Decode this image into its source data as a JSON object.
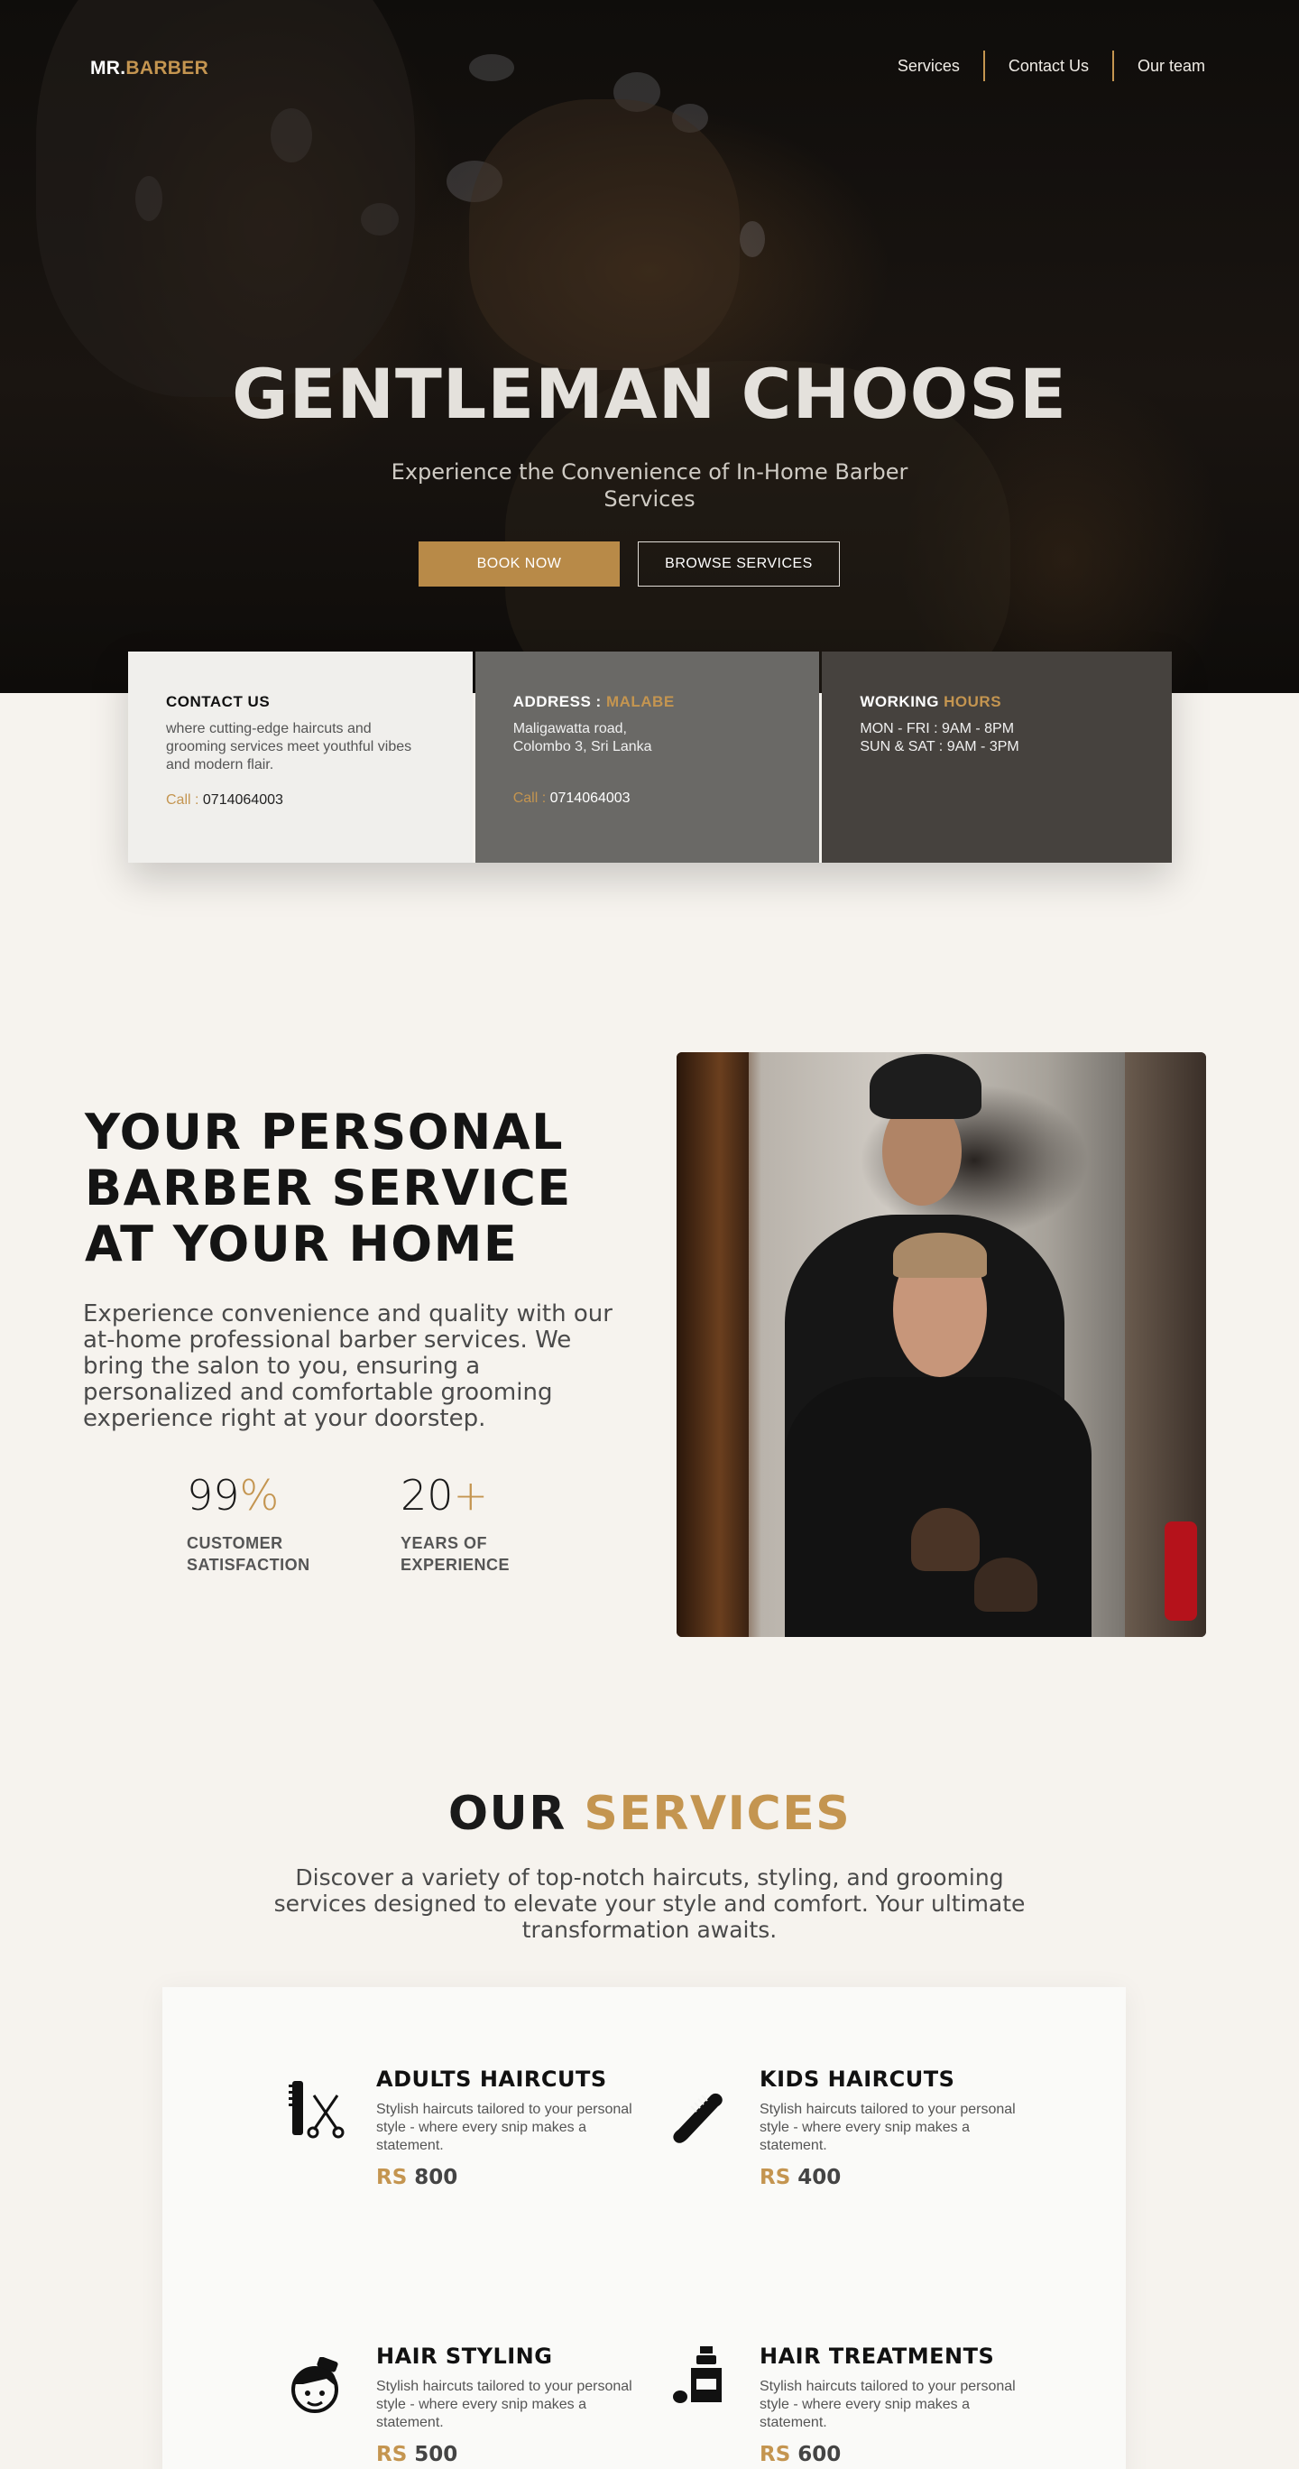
{
  "brand": {
    "part1": "MR.",
    "part2": "BARBER"
  },
  "nav": {
    "items": [
      "Services",
      "Contact Us",
      "Our team"
    ]
  },
  "hero": {
    "title": "GENTLEMAN CHOOSE",
    "subtitle": "Experience the Convenience of In-Home Barber Services",
    "book_label": "BOOK NOW",
    "browse_label": "BROWSE SERVICES"
  },
  "cards": {
    "contact": {
      "title": "CONTACT US",
      "text": "where cutting-edge haircuts and grooming services meet youthful vibes and modern flair.",
      "call_label": "Call :",
      "phone": "0714064003"
    },
    "address": {
      "title": "ADDRESS :",
      "title_accent": "MALABE",
      "line1": "Maligawatta road,",
      "line2": "Colombo 3, Sri Lanka",
      "call_label": "Call :",
      "phone": "0714064003"
    },
    "hours": {
      "title": "WORKING",
      "title_accent": "HOURS",
      "line1": "MON - FRI : 9AM - 8PM",
      "line2": "SUN & SAT : 9AM - 3PM"
    }
  },
  "about": {
    "title": "YOUR PERSONAL BARBER SERVICE AT YOUR HOME",
    "text": "Experience convenience and quality with our at-home professional barber services. We bring the salon to you, ensuring a personalized and comfortable grooming experience right at your doorstep.",
    "stats": [
      {
        "number": "99",
        "suffix": "%",
        "label1": "CUSTOMER",
        "label2": "SATISFACTION"
      },
      {
        "number": "20",
        "suffix": "+",
        "label1": "YEARS OF",
        "label2": "EXPERIENCE"
      }
    ]
  },
  "services": {
    "title1": "OUR",
    "title2": "SERVICES",
    "subtitle": "Discover a variety of top-notch haircuts, styling, and grooming services designed to elevate your style and comfort. Your ultimate transformation awaits.",
    "items": [
      {
        "name": "ADULTS HAIRCUTS",
        "desc": "Stylish haircuts tailored to your personal style - where every snip makes a statement.",
        "currency": "RS",
        "price": "800",
        "icon": "comb-scissors-icon"
      },
      {
        "name": "KIDS HAIRCUTS",
        "desc": "Stylish haircuts tailored to your personal style - where every snip makes a statement.",
        "currency": "RS",
        "price": "400",
        "icon": "comb-icon"
      },
      {
        "name": "HAIR STYLING",
        "desc": "Stylish haircuts tailored to your personal style - where every snip makes a statement.",
        "currency": "RS",
        "price": "500",
        "icon": "hair-styling-icon"
      },
      {
        "name": "HAIR TREATMENTS",
        "desc": "Stylish haircuts tailored to your personal style - where every snip makes a statement.",
        "currency": "RS",
        "price": "600",
        "icon": "bottle-icon"
      }
    ]
  },
  "colors": {
    "accent": "#c49550",
    "page_bg": "#f6f3ee",
    "dark": "#46423e"
  }
}
